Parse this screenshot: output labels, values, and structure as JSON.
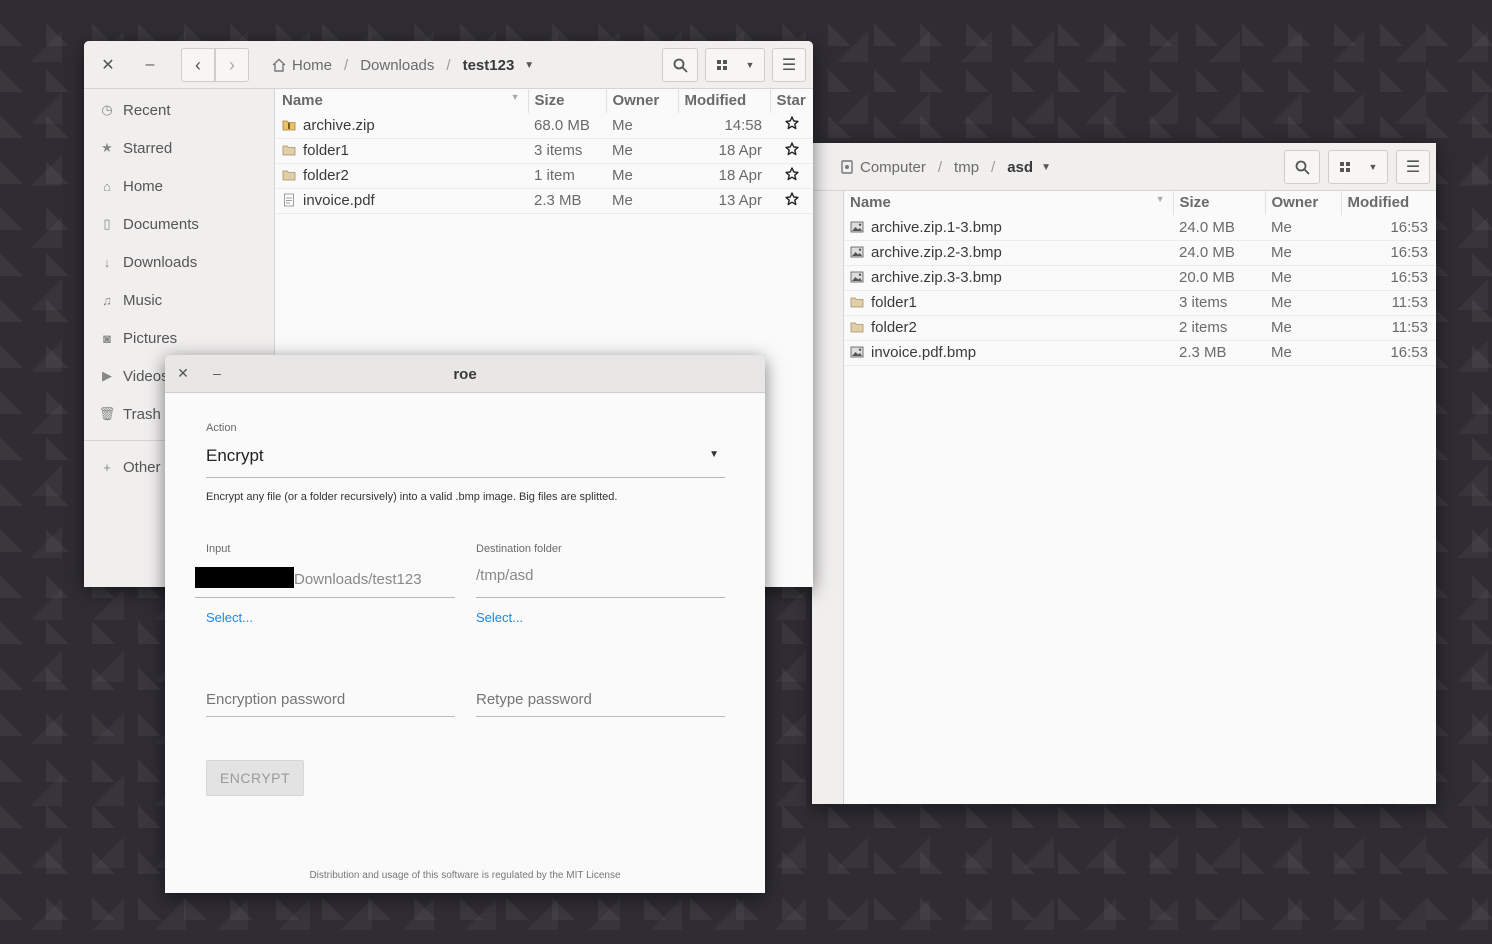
{
  "left_window": {
    "breadcrumb": [
      "Home",
      "Downloads",
      "test123"
    ],
    "sidebar": [
      {
        "label": "Recent",
        "icon": "clock-icon"
      },
      {
        "label": "Starred",
        "icon": "star-icon"
      },
      {
        "label": "Home",
        "icon": "home-icon"
      },
      {
        "label": "Documents",
        "icon": "document-icon"
      },
      {
        "label": "Downloads",
        "icon": "download-icon"
      },
      {
        "label": "Music",
        "icon": "music-icon"
      },
      {
        "label": "Pictures",
        "icon": "camera-icon"
      },
      {
        "label": "Videos",
        "icon": "video-icon"
      },
      {
        "label": "Trash",
        "icon": "trash-icon"
      },
      {
        "label": "Other",
        "icon": "plus-icon"
      }
    ],
    "columns": {
      "name": "Name",
      "size": "Size",
      "owner": "Owner",
      "modified": "Modified",
      "star": "Star"
    },
    "files": [
      {
        "name": "archive.zip",
        "size": "68.0 MB",
        "owner": "Me",
        "modified": "14:58",
        "type": "archive"
      },
      {
        "name": "folder1",
        "size": "3 items",
        "owner": "Me",
        "modified": "18 Apr",
        "type": "folder"
      },
      {
        "name": "folder2",
        "size": "1 item",
        "owner": "Me",
        "modified": "18 Apr",
        "type": "folder"
      },
      {
        "name": "invoice.pdf",
        "size": "2.3 MB",
        "owner": "Me",
        "modified": "13 Apr",
        "type": "pdf"
      }
    ]
  },
  "right_window": {
    "breadcrumb": [
      "Computer",
      "tmp",
      "asd"
    ],
    "columns": {
      "name": "Name",
      "size": "Size",
      "owner": "Owner",
      "modified": "Modified"
    },
    "files": [
      {
        "name": "archive.zip.1-3.bmp",
        "size": "24.0 MB",
        "owner": "Me",
        "modified": "16:53",
        "type": "image"
      },
      {
        "name": "archive.zip.2-3.bmp",
        "size": "24.0 MB",
        "owner": "Me",
        "modified": "16:53",
        "type": "image"
      },
      {
        "name": "archive.zip.3-3.bmp",
        "size": "20.0 MB",
        "owner": "Me",
        "modified": "16:53",
        "type": "image"
      },
      {
        "name": "folder1",
        "size": "3 items",
        "owner": "Me",
        "modified": "11:53",
        "type": "folder"
      },
      {
        "name": "folder2",
        "size": "2 items",
        "owner": "Me",
        "modified": "11:53",
        "type": "folder"
      },
      {
        "name": "invoice.pdf.bmp",
        "size": "2.3 MB",
        "owner": "Me",
        "modified": "16:53",
        "type": "image"
      }
    ]
  },
  "dialog": {
    "title": "roe",
    "action_label": "Action",
    "action_value": "Encrypt",
    "description": "Encrypt any file (or a folder recursively) into a valid .bmp image. Big files are splitted.",
    "input_label": "Input",
    "input_value": "Downloads/test123",
    "destination_label": "Destination folder",
    "destination_value": "/tmp/asd",
    "select_label": "Select...",
    "password_placeholder": "Encryption password",
    "retype_placeholder": "Retype password",
    "submit_label": "ENCRYPT",
    "footer": "Distribution and usage of this software is regulated by the MIT License"
  },
  "colors": {
    "accent_link": "#1e88e5",
    "folder": "#e0cfa8",
    "desktop": "#2f2d33"
  }
}
